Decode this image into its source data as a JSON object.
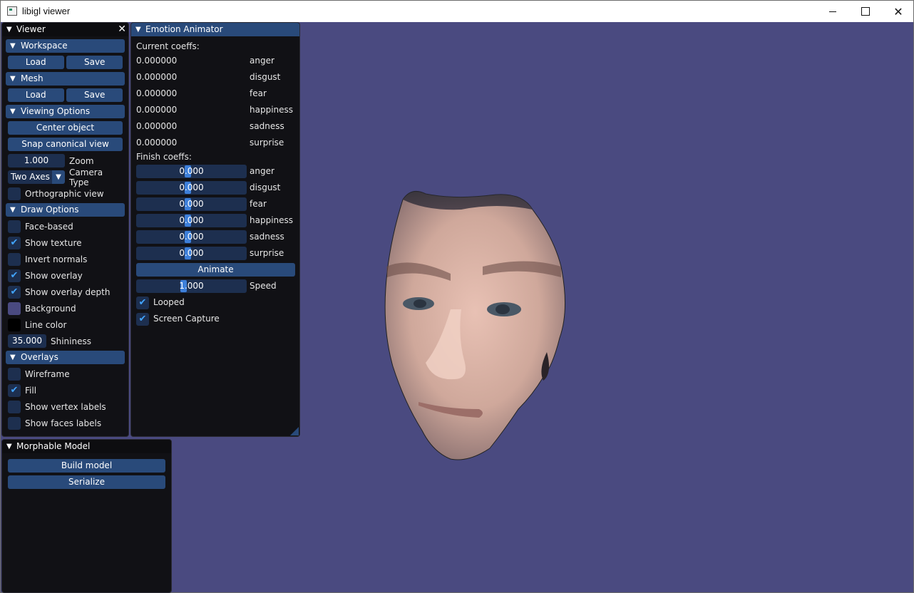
{
  "window": {
    "title": "libigl viewer",
    "min_glyph": "",
    "max_glyph": "",
    "close_glyph": "✕"
  },
  "colors": {
    "background": "#4a4a80",
    "panel": "#111115",
    "header": "#294a7a",
    "field": "#1d2f4f",
    "check": "#42a5ff",
    "line_color": "#000000",
    "background_swatch": "#4a4a80"
  },
  "viewer": {
    "title": "Viewer",
    "close_glyph": "✕",
    "workspace": {
      "label": "Workspace",
      "load": "Load",
      "save": "Save"
    },
    "mesh": {
      "label": "Mesh",
      "load": "Load",
      "save": "Save"
    },
    "viewing": {
      "label": "Viewing Options",
      "center": "Center object",
      "snap": "Snap canonical view",
      "zoom_value": "1.000",
      "zoom_label": "Zoom",
      "camera_value": "Two Axes",
      "camera_label": "Camera Type",
      "ortho_label": "Orthographic view"
    },
    "draw": {
      "label": "Draw Options",
      "face_based": "Face-based",
      "show_texture": "Show texture",
      "invert_normals": "Invert normals",
      "show_overlay": "Show overlay",
      "show_overlay_depth": "Show overlay depth",
      "background": "Background",
      "line_color": "Line color",
      "shininess_value": "35.000",
      "shininess_label": "Shininess"
    },
    "overlays": {
      "label": "Overlays",
      "wireframe": "Wireframe",
      "fill": "Fill",
      "vertex_labels": "Show vertex labels",
      "face_labels": "Show faces labels"
    }
  },
  "emotion": {
    "title": "Emotion Animator",
    "current_label": "Current coeffs:",
    "finish_label": "Finish coeffs:",
    "emotions": [
      "anger",
      "disgust",
      "fear",
      "happiness",
      "sadness",
      "surprise"
    ],
    "current_values": [
      "0.000000",
      "0.000000",
      "0.000000",
      "0.000000",
      "0.000000",
      "0.000000"
    ],
    "finish_values": [
      "0.000",
      "0.000",
      "0.000",
      "0.000",
      "0.000",
      "0.000"
    ],
    "animate": "Animate",
    "speed_value": "1.000",
    "speed_label": "Speed",
    "looped": "Looped",
    "screen_capture": "Screen Capture"
  },
  "morphable": {
    "title": "Morphable Model",
    "build": "Build model",
    "serialize": "Serialize"
  },
  "check_glyph": "✔",
  "tri_glyph": "▼"
}
